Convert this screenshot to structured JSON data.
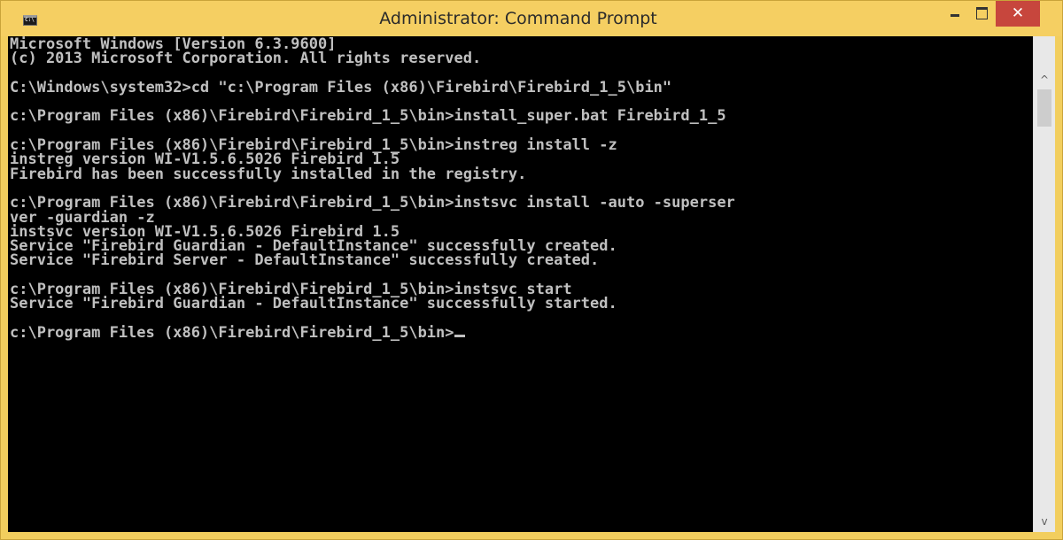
{
  "window": {
    "title": "Administrator: Command Prompt",
    "icon": "cmd-icon",
    "controls": {
      "minimize_icon": "minimize-icon",
      "maximize_icon": "maximize-icon",
      "close_label": "✕"
    }
  },
  "console": {
    "lines": [
      "Microsoft Windows [Version 6.3.9600]",
      "(c) 2013 Microsoft Corporation. All rights reserved.",
      "",
      "C:\\Windows\\system32>cd \"c:\\Program Files (x86)\\Firebird\\Firebird_1_5\\bin\"",
      "",
      "c:\\Program Files (x86)\\Firebird\\Firebird_1_5\\bin>install_super.bat Firebird_1_5",
      "",
      "c:\\Program Files (x86)\\Firebird\\Firebird_1_5\\bin>instreg install -z",
      "instreg version WI-V1.5.6.5026 Firebird 1.5",
      "Firebird has been successfully installed in the registry.",
      "",
      "c:\\Program Files (x86)\\Firebird\\Firebird_1_5\\bin>instsvc install -auto -superser",
      "ver -guardian -z",
      "instsvc version WI-V1.5.6.5026 Firebird 1.5",
      "Service \"Firebird Guardian - DefaultInstance\" successfully created.",
      "Service \"Firebird Server - DefaultInstance\" successfully created.",
      "",
      "c:\\Program Files (x86)\\Firebird\\Firebird_1_5\\bin>instsvc start",
      "Service \"Firebird Guardian - DefaultInstance\" successfully started.",
      "",
      "c:\\Program Files (x86)\\Firebird\\Firebird_1_5\\bin>"
    ],
    "text_color": "#c0c0c0",
    "background_color": "#000000"
  },
  "scrollbar": {
    "up_arrow": "^",
    "down_arrow": "v"
  },
  "colors": {
    "titlebar": "#f5cf62",
    "close_button": "#c7463d"
  }
}
